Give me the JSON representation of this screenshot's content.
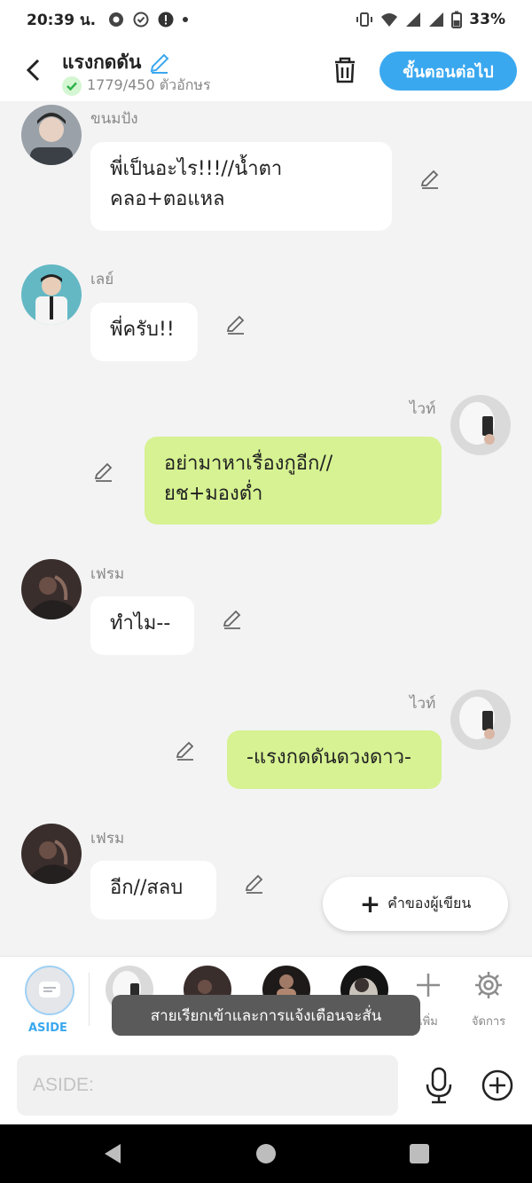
{
  "status": {
    "time": "20:39 น.",
    "battery": "33%"
  },
  "header": {
    "title": "แรงกดดัน",
    "counter": "1779/450 ตัวอักษร",
    "next_label": "ขั้นตอนต่อไป"
  },
  "messages": [
    {
      "sender": "ขนมปัง",
      "text_line1": "พี่เป็นอะไร!!!//น้ำตา",
      "text_line2": "คลอ+ตอแหล",
      "side": "left"
    },
    {
      "sender": "เลย์",
      "text_line1": "พี่ครับ!!",
      "side": "left"
    },
    {
      "sender": "ไวท์",
      "text_line1": "อย่ามาหาเรื่องกูอีก//",
      "text_line2": "ยช+มองต่ำ",
      "side": "right"
    },
    {
      "sender": "เฟรม",
      "text_line1": "ทำไม--",
      "side": "left"
    },
    {
      "sender": "ไวท์",
      "text_line1": "-แรงกดดันดวงดาว-",
      "side": "right"
    },
    {
      "sender": "เฟรม",
      "text_line1": "อีก//สลบ",
      "side": "left"
    }
  ],
  "fab": {
    "label": "คำของผู้เขียน"
  },
  "charbar": {
    "aside_label": "ASIDE",
    "add_label": "เพิ่ม",
    "manage_label": "จัดการ"
  },
  "toast": {
    "text": "สายเรียกเข้าและการแจ้งเตือนจะสั่น"
  },
  "input": {
    "placeholder": "ASIDE:"
  },
  "colors": {
    "accent": "#3aa8ef",
    "right_bubble": "#d6f292",
    "left_bubble": "#ffffff",
    "background": "#f3f3f4"
  }
}
